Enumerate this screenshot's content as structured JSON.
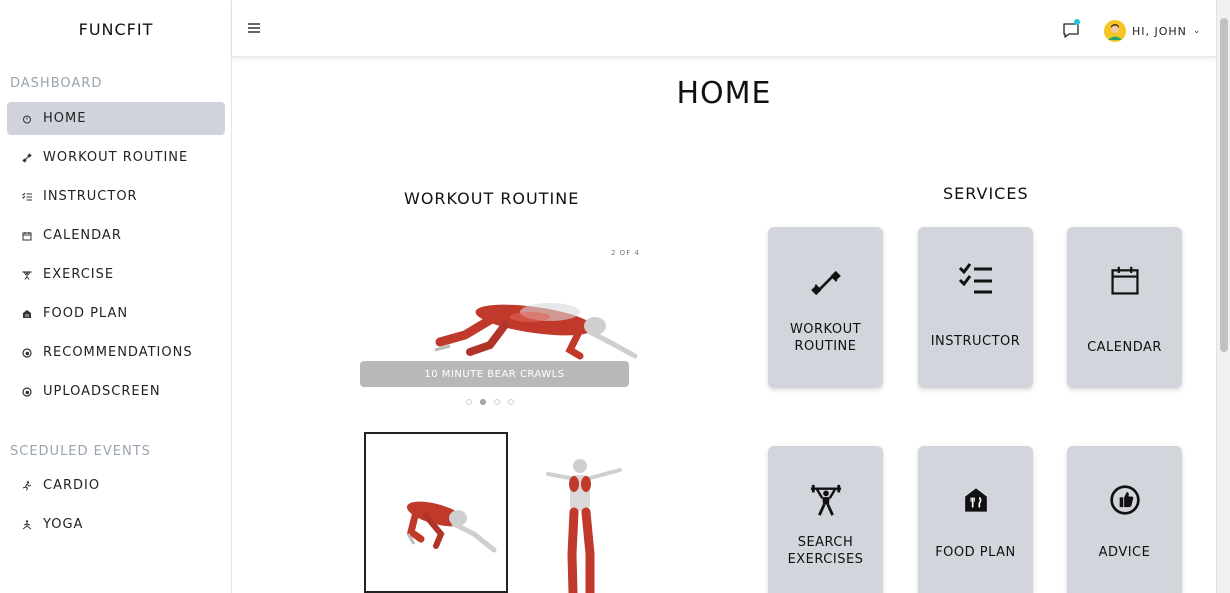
{
  "app": {
    "brand": "FUNCFIT"
  },
  "sidebar": {
    "dashboard_title": "DASHBOARD",
    "items": [
      {
        "label": "HOME",
        "icon": "home-icon",
        "active": true
      },
      {
        "label": "WORKOUT ROUTINE",
        "icon": "dumbbell-icon"
      },
      {
        "label": "INSTRUCTOR",
        "icon": "checklist-icon"
      },
      {
        "label": "CALENDAR",
        "icon": "calendar-icon"
      },
      {
        "label": "EXERCISE",
        "icon": "weightlifter-icon"
      },
      {
        "label": "FOOD PLAN",
        "icon": "food-icon"
      },
      {
        "label": "RECOMMENDATIONS",
        "icon": "thumbs-up-icon"
      },
      {
        "label": "UPLOADSCREEN",
        "icon": "thumbs-up-icon"
      }
    ],
    "events_title": "SCEDULED EVENTS",
    "events": [
      {
        "label": "CARDIO",
        "icon": "runner-icon"
      },
      {
        "label": "YOGA",
        "icon": "yoga-icon"
      }
    ]
  },
  "header": {
    "user_greeting": "HI,  JOHN",
    "notification_color": "#18c7e0"
  },
  "main": {
    "title": "HOME",
    "workout_title": "WORKOUT ROUTINE",
    "services_title": "SERVICES",
    "carousel": {
      "counter": "2 OF 4",
      "caption": "10 MINUTE BEAR CRAWLS",
      "current": 2,
      "total": 4
    },
    "services": [
      {
        "label": "WORKOUT ROUTINE",
        "icon": "dumbbell-icon"
      },
      {
        "label": "INSTRUCTOR",
        "icon": "checklist-icon"
      },
      {
        "label": "CALENDAR",
        "icon": "calendar-icon"
      },
      {
        "label": "SEARCH EXERCISES",
        "icon": "weightlifter-icon"
      },
      {
        "label": "FOOD PLAN",
        "icon": "food-icon"
      },
      {
        "label": "ADVICE",
        "icon": "thumbs-up-icon"
      }
    ]
  },
  "colors": {
    "active_bg": "#d0d3dc",
    "card_bg": "#d2d5dc",
    "muscle": "#c0392b"
  }
}
